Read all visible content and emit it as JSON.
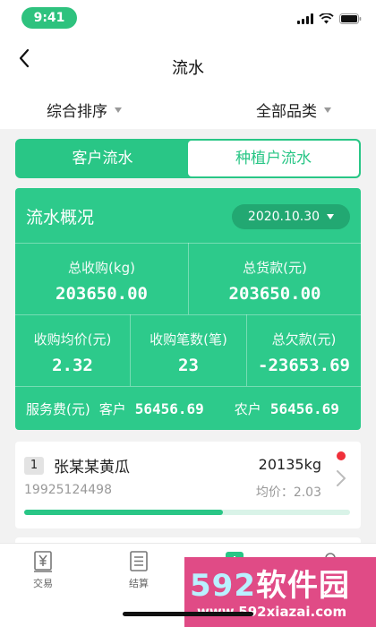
{
  "status_bar": {
    "time": "9:41"
  },
  "nav": {
    "title": "流水"
  },
  "filters": {
    "sort_label": "综合排序",
    "category_label": "全部品类"
  },
  "segment": {
    "tab_customer": "客户流水",
    "tab_grower": "种植户流水",
    "active": "tab_grower"
  },
  "overview": {
    "title": "流水概况",
    "date": "2020.10.30",
    "total_purchase_label": "总收购(kg)",
    "total_purchase_value": "203650.00",
    "total_payment_label": "总货款(元)",
    "total_payment_value": "203650.00",
    "avg_price_label": "收购均价(元)",
    "avg_price_value": "2.32",
    "count_label": "收购笔数(笔)",
    "count_value": "23",
    "arrears_label": "总欠款(元)",
    "arrears_value": "-23653.69",
    "fee_label": "服务费(元)",
    "customer_label": "客户",
    "customer_value": "56456.69",
    "farmer_label": "农户",
    "farmer_value": "56456.69"
  },
  "record": {
    "rank": "1",
    "name": "张某某黄瓜",
    "weight": "20135kg",
    "phone": "19925124498",
    "avg_price": "均价：2.03",
    "progress": 0.61
  },
  "tabbar": {
    "tab1": "交易",
    "tab2": "结算"
  },
  "watermark": {
    "brand_num": "592",
    "brand_text": "软件园",
    "url": "www.592xiazai.com"
  },
  "colors": {
    "accent": "#29c686",
    "panel": "#2dca8b",
    "alert": "#f0303a"
  }
}
